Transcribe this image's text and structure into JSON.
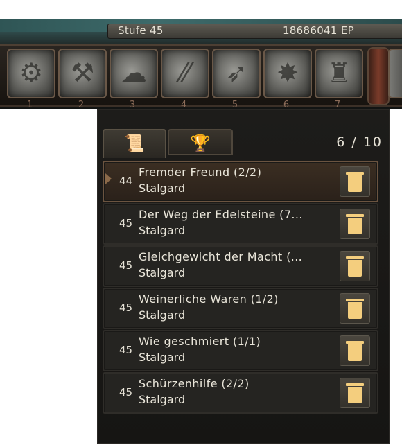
{
  "header": {
    "level_label": "Stufe 45",
    "ep_label": "18686041 EP"
  },
  "skills": [
    {
      "number": "1",
      "icon": "turret-icon"
    },
    {
      "number": "2",
      "icon": "robot-turret-icon"
    },
    {
      "number": "3",
      "icon": "smoke-icon"
    },
    {
      "number": "4",
      "icon": "rain-icon"
    },
    {
      "number": "5",
      "icon": "missile-icon"
    },
    {
      "number": "6",
      "icon": "explosion-icon"
    },
    {
      "number": "7",
      "icon": "golem-icon"
    }
  ],
  "quest_panel": {
    "tabs": [
      {
        "name": "scroll-tab",
        "icon": "scroll-icon"
      },
      {
        "name": "trophy-tab",
        "icon": "trophy-icon"
      }
    ],
    "count": "6 / 10",
    "quests": [
      {
        "level": "44",
        "title": "Fremder Freund (2/2)",
        "location": "Stalgard",
        "selected": true
      },
      {
        "level": "45",
        "title": "Der Weg der Edelsteine (7...",
        "location": "Stalgard",
        "selected": false
      },
      {
        "level": "45",
        "title": "Gleichgewicht der Macht (...",
        "location": "Stalgard",
        "selected": false
      },
      {
        "level": "45",
        "title": "Weinerliche Waren (1/2)",
        "location": "Stalgard",
        "selected": false
      },
      {
        "level": "45",
        "title": "Wie geschmiert (1/1)",
        "location": "Stalgard",
        "selected": false
      },
      {
        "level": "45",
        "title": "Schürzenhilfe (2/2)",
        "location": "Stalgard",
        "selected": false
      }
    ]
  }
}
